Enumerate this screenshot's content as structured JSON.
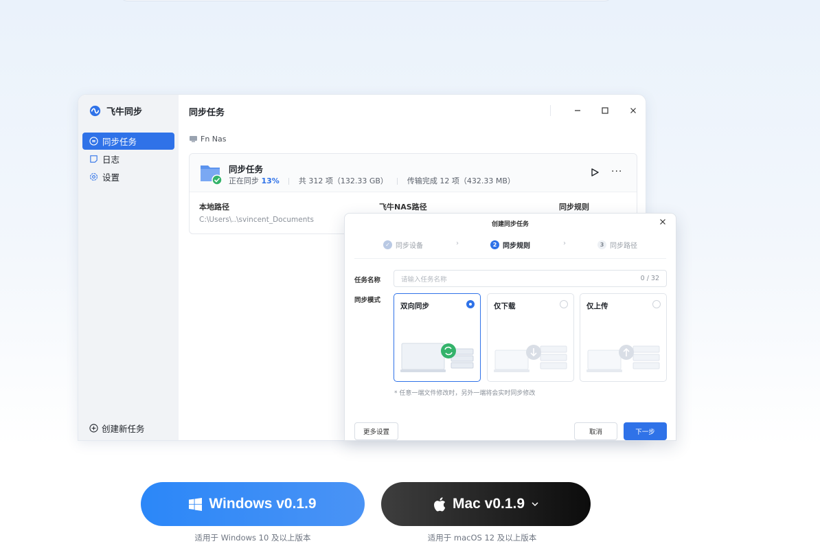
{
  "app": {
    "brand": "飞牛同步",
    "window_title": "同步任务",
    "sidebar": {
      "items": [
        {
          "label": "同步任务",
          "icon": "sync-circle-icon",
          "active": true
        },
        {
          "label": "日志",
          "icon": "log-icon",
          "active": false
        },
        {
          "label": "设置",
          "icon": "gear-icon",
          "active": false
        }
      ],
      "new_task": "创建新任务"
    },
    "device": "Fn Nas",
    "task": {
      "name": "同步任务",
      "status_prefix": "正在同步",
      "progress": "13%",
      "total": "共 312 项（132.33 GB）",
      "transferred": "传输完成 12 项（432.33 MB）",
      "col_local": "本地路径",
      "col_nas": "飞牛NAS路径",
      "col_rule": "同步规则",
      "local_path": "C:\\Users\\..\\svincent_Documents"
    }
  },
  "dialog": {
    "title": "创建同步任务",
    "steps": [
      {
        "num": "✓",
        "label": "同步设备",
        "state": "done"
      },
      {
        "num": "2",
        "label": "同步规则",
        "state": "active"
      },
      {
        "num": "3",
        "label": "同步路径",
        "state": "todo"
      }
    ],
    "name_label": "任务名称",
    "name_placeholder": "请输入任务名称",
    "name_counter": "0 / 32",
    "mode_label": "同步模式",
    "modes": [
      {
        "label": "双向同步",
        "selected": true
      },
      {
        "label": "仅下载",
        "selected": false
      },
      {
        "label": "仅上传",
        "selected": false
      }
    ],
    "hint": "* 任意一端文件修改时，另外一端将会实时同步修改",
    "more_settings": "更多设置",
    "cancel": "取消",
    "next": "下一步"
  },
  "downloads": {
    "windows": {
      "label": "Windows v0.1.9",
      "note": "适用于 Windows 10 及以上版本"
    },
    "mac": {
      "label": "Mac v0.1.9",
      "note": "适用于 macOS 12 及以上版本"
    }
  },
  "colors": {
    "accent": "#2f72e8",
    "success": "#34b36b"
  }
}
